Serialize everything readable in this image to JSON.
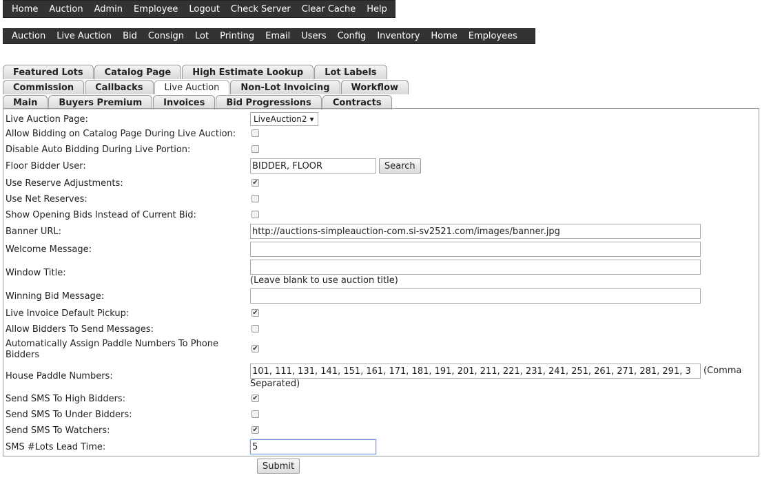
{
  "top_nav": [
    "Home",
    "Auction",
    "Admin",
    "Employee",
    "Logout",
    "Check Server",
    "Clear Cache",
    "Help"
  ],
  "sub_nav": [
    "Auction",
    "Live Auction",
    "Bid",
    "Consign",
    "Lot",
    "Printing",
    "Email",
    "Users",
    "Config",
    "Inventory",
    "Home",
    "Employees"
  ],
  "tabs": {
    "row1": [
      "Featured Lots",
      "Catalog Page",
      "High Estimate Lookup",
      "Lot Labels"
    ],
    "row2": [
      "Commission",
      "Callbacks",
      "Live Auction",
      "Non-Lot Invoicing",
      "Workflow"
    ],
    "row3": [
      "Main",
      "Buyers Premium",
      "Invoices",
      "Bid Progressions",
      "Contracts"
    ],
    "active": "Live Auction"
  },
  "form": {
    "live_auction_page": {
      "label": "Live Auction Page:",
      "value": "LiveAuction2",
      "arrow": "▾"
    },
    "allow_bidding_catalog": {
      "label": "Allow Bidding on Catalog Page During Live Auction:",
      "checked": false
    },
    "disable_auto_bidding": {
      "label": "Disable Auto Bidding During Live Portion:",
      "checked": false
    },
    "floor_bidder": {
      "label": "Floor Bidder User:",
      "value": "BIDDER, FLOOR",
      "button": "Search"
    },
    "use_reserve_adj": {
      "label": "Use Reserve Adjustments:",
      "checked": true
    },
    "use_net_reserves": {
      "label": "Use Net Reserves:",
      "checked": false
    },
    "show_opening_bids": {
      "label": "Show Opening Bids Instead of Current Bid:",
      "checked": false
    },
    "banner_url": {
      "label": "Banner URL:",
      "value": "http://auctions-simpleauction-com.si-sv2521.com/images/banner.jpg"
    },
    "welcome_message": {
      "label": "Welcome Message:",
      "value": ""
    },
    "window_title": {
      "label": "Window Title:",
      "value": "",
      "note": "(Leave blank to use auction title)"
    },
    "winning_bid_message": {
      "label": "Winning Bid Message:",
      "value": ""
    },
    "live_invoice_pickup": {
      "label": "Live Invoice Default Pickup:",
      "checked": true
    },
    "allow_bidders_messages": {
      "label": "Allow Bidders To Send Messages:",
      "checked": false
    },
    "auto_assign_paddle": {
      "label": "Automatically Assign Paddle Numbers To Phone Bidders",
      "checked": true
    },
    "house_paddle_numbers": {
      "label": "House Paddle Numbers:",
      "value": "101, 111, 131, 141, 151, 161, 171, 181, 191, 201, 211, 221, 231, 241, 251, 261, 271, 281, 291, 3",
      "note_a": "(Comma",
      "note_b": "Separated)"
    },
    "sms_high_bidders": {
      "label": "Send SMS To High Bidders:",
      "checked": true
    },
    "sms_under_bidders": {
      "label": "Send SMS To Under Bidders:",
      "checked": false
    },
    "sms_watchers": {
      "label": "Send SMS To Watchers:",
      "checked": true
    },
    "sms_lead_time": {
      "label": "SMS #Lots Lead Time:",
      "value": "5"
    },
    "submit": "Submit"
  },
  "check_glyph": "✔"
}
